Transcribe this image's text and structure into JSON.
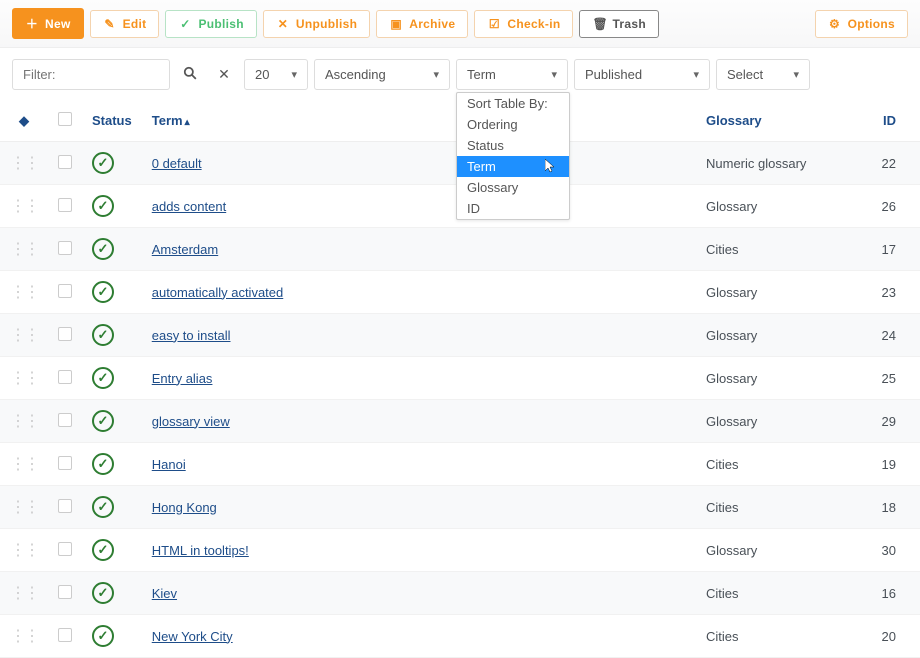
{
  "toolbar": {
    "new": "New",
    "edit": "Edit",
    "publish": "Publish",
    "unpublish": "Unpublish",
    "archive": "Archive",
    "checkin": "Check-in",
    "trash": "Trash",
    "options": "Options"
  },
  "filterbar": {
    "filter_placeholder": "Filter:",
    "per_page": "20",
    "direction": "Ascending",
    "sort_by": "Term",
    "published": "Published",
    "select": "Select"
  },
  "dropdown": {
    "header": "Sort Table By:",
    "items": [
      "Ordering",
      "Status",
      "Term",
      "Glossary",
      "ID"
    ],
    "highlighted": "Term"
  },
  "columns": {
    "status": "Status",
    "term": "Term",
    "glossary": "Glossary",
    "id": "ID"
  },
  "rows": [
    {
      "term": "0 default",
      "glossary": "Numeric glossary",
      "id": 22
    },
    {
      "term": "adds content",
      "glossary": "Glossary",
      "id": 26
    },
    {
      "term": "Amsterdam",
      "glossary": "Cities",
      "id": 17
    },
    {
      "term": "automatically activated",
      "glossary": "Glossary",
      "id": 23
    },
    {
      "term": "easy to install",
      "glossary": "Glossary",
      "id": 24
    },
    {
      "term": "Entry alias",
      "glossary": "Glossary",
      "id": 25
    },
    {
      "term": "glossary view",
      "glossary": "Glossary",
      "id": 29
    },
    {
      "term": "Hanoi",
      "glossary": "Cities",
      "id": 19
    },
    {
      "term": "Hong Kong",
      "glossary": "Cities",
      "id": 18
    },
    {
      "term": "HTML in tooltips!",
      "glossary": "Glossary",
      "id": 30
    },
    {
      "term": "Kiev",
      "glossary": "Cities",
      "id": 16
    },
    {
      "term": "New York City",
      "glossary": "Cities",
      "id": 20
    }
  ]
}
